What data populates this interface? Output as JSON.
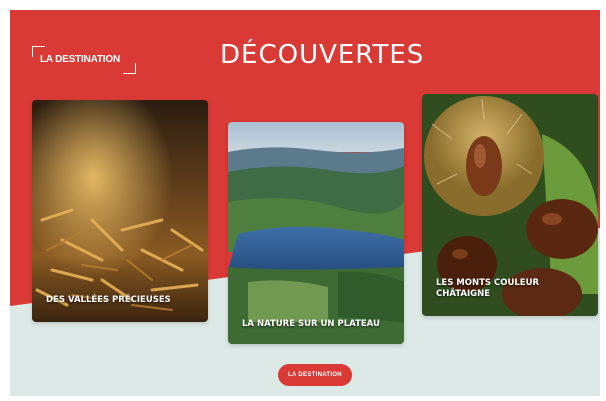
{
  "header": {
    "tag_label": "LA DESTINATION",
    "title": "DÉCOUVERTES"
  },
  "cards": [
    {
      "label": "DES VALLÉES PRÉCIEUSES",
      "image": "golden-metal-pins-photo"
    },
    {
      "label": "LA NATURE SUR UN PLATEAU",
      "image": "lake-and-hills-aerial-photo"
    },
    {
      "label": "LES MONTS COULEUR CHÂTAIGNE",
      "image": "chestnuts-in-burr-photo"
    }
  ],
  "cta": {
    "label": "LA DESTINATION"
  },
  "colors": {
    "brand_red": "#d93a36",
    "background_light": "#dce9e6",
    "text_white": "#ffffff"
  }
}
